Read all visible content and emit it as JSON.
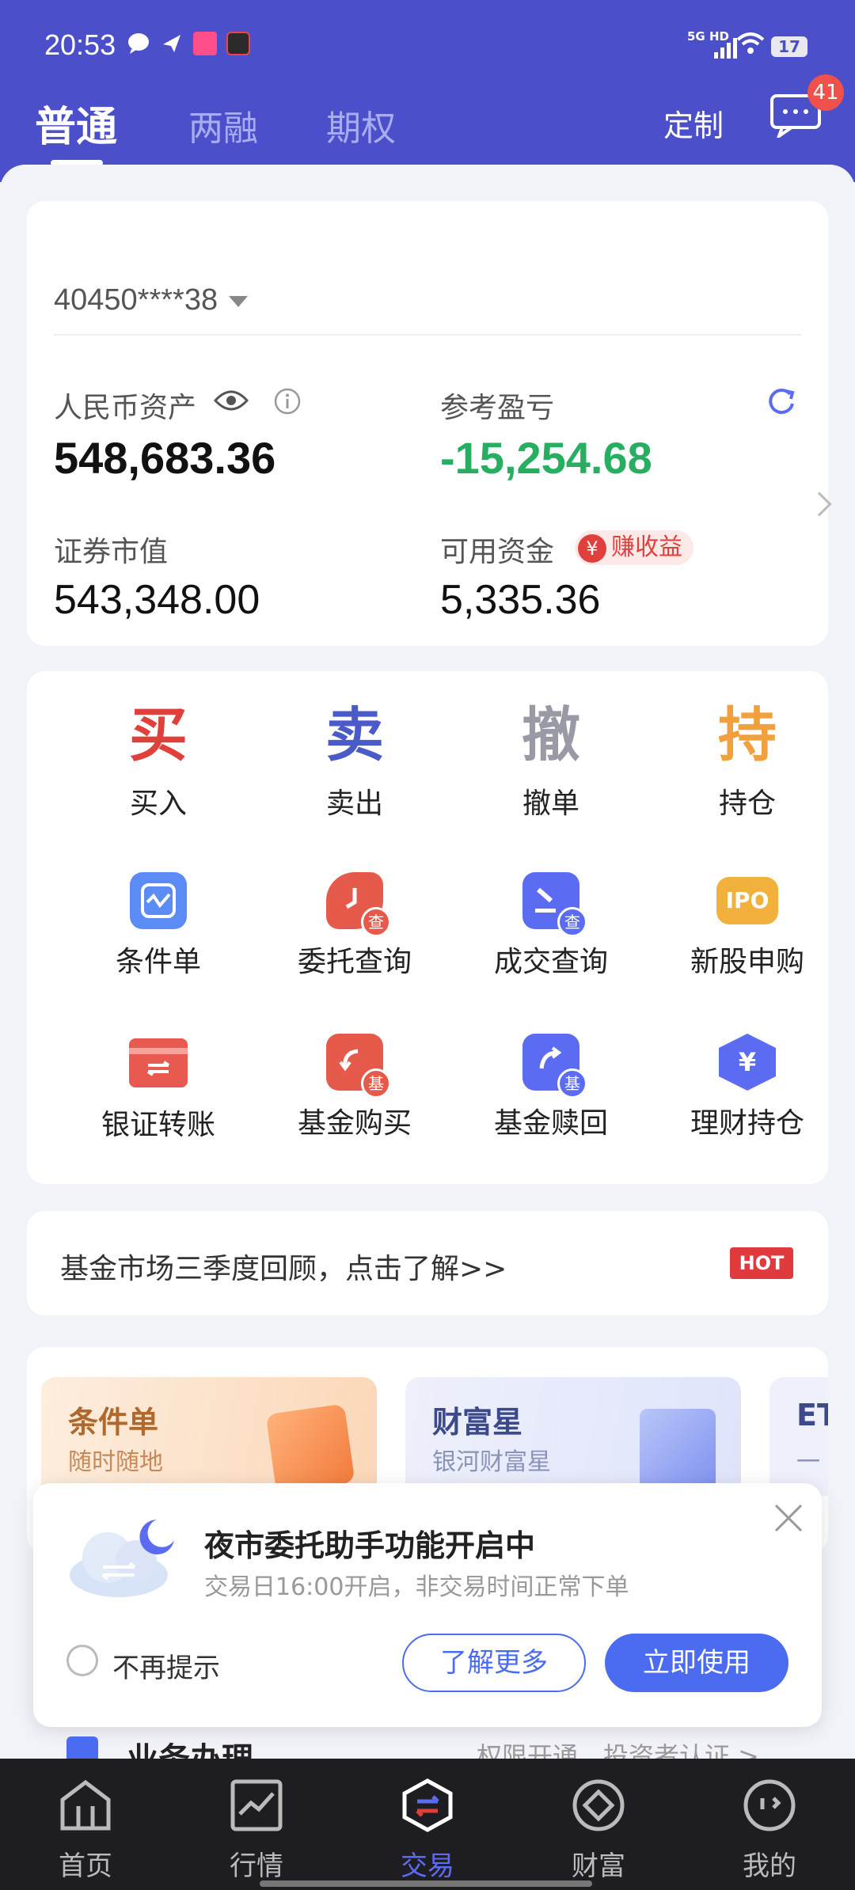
{
  "status_bar": {
    "time": "20:53",
    "network": "5G HD",
    "battery": "17"
  },
  "top_tabs": [
    "普通",
    "两融",
    "期权"
  ],
  "header": {
    "customize": "定制",
    "message_count": "41"
  },
  "account": {
    "id": "40450****38",
    "rmb_assets_label": "人民币资产",
    "rmb_assets_value": "548,683.36",
    "ref_pnl_label": "参考盈亏",
    "ref_pnl_value": "-15,254.68",
    "market_value_label": "证券市值",
    "market_value_value": "543,348.00",
    "available_label": "可用资金",
    "available_value": "5,335.36",
    "earn_tag": "赚收益",
    "earn_symbol": "¥"
  },
  "trade_actions": [
    {
      "char": "买",
      "label": "买入",
      "color": "#e0403c"
    },
    {
      "char": "卖",
      "label": "卖出",
      "color": "#4b5ac9"
    },
    {
      "char": "撤",
      "label": "撤单",
      "color": "#9a9aa6"
    },
    {
      "char": "持",
      "label": "持仓",
      "color": "#f0a03c"
    }
  ],
  "tools_row1": [
    {
      "label": "条件单",
      "icon": "condition-order-icon"
    },
    {
      "label": "委托查询",
      "icon": "order-query-icon",
      "sub": "查"
    },
    {
      "label": "成交查询",
      "icon": "deal-query-icon",
      "sub": "查"
    },
    {
      "label": "新股申购",
      "icon": "ipo-icon",
      "text": "IPO"
    }
  ],
  "tools_row2": [
    {
      "label": "银证转账",
      "icon": "bank-transfer-icon"
    },
    {
      "label": "基金购买",
      "icon": "fund-buy-icon",
      "sub": "基"
    },
    {
      "label": "基金赎回",
      "icon": "fund-redeem-icon",
      "sub": "基"
    },
    {
      "label": "理财持仓",
      "icon": "wealth-holding-icon",
      "text": "¥"
    }
  ],
  "banner": {
    "text": "基金市场三季度回顾，点击了解>>",
    "tag": "HOT"
  },
  "promos": [
    {
      "title": "条件单",
      "subtitle": "随时随地"
    },
    {
      "title": "财富星",
      "subtitle": "银河财富星"
    },
    {
      "title": "ET",
      "subtitle": "一"
    }
  ],
  "popup": {
    "title": "夜市委托助手功能开启中",
    "subtitle": "交易日16:00开启，非交易时间正常下单",
    "no_remind": "不再提示",
    "learn_more": "了解更多",
    "use_now": "立即使用"
  },
  "business": {
    "title": "业务办理",
    "links": "权限开通、投资者认证 >"
  },
  "bottom_nav": [
    {
      "label": "首页",
      "icon": "home-icon"
    },
    {
      "label": "行情",
      "icon": "market-icon"
    },
    {
      "label": "交易",
      "icon": "trade-icon"
    },
    {
      "label": "财富",
      "icon": "wealth-icon"
    },
    {
      "label": "我的",
      "icon": "profile-icon"
    }
  ]
}
